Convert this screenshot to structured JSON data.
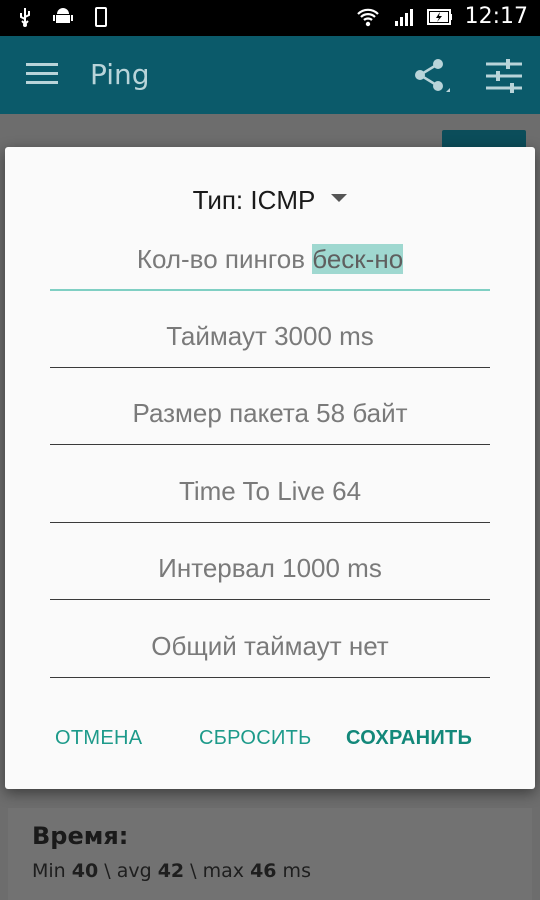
{
  "status_bar": {
    "time": "12:17",
    "icons": [
      "usb-icon",
      "android-debug-icon",
      "screenshot-icon",
      "wifi-icon",
      "signal-icon",
      "battery-charging-icon"
    ]
  },
  "app_bar": {
    "title": "Ping",
    "icons": [
      "menu-icon",
      "share-icon",
      "tune-icon"
    ]
  },
  "dialog": {
    "type_label": "Тип: ICMP",
    "fields": [
      {
        "label": "Кол-во пингов ",
        "value": "беск-но",
        "highlight": true
      },
      {
        "label": "Таймаут 3000 ms"
      },
      {
        "label": "Размер пакета 58 байт"
      },
      {
        "label": "Time To Live 64"
      },
      {
        "label": "Интервал 1000 ms"
      },
      {
        "label": "Общий таймаут нет"
      }
    ],
    "actions": {
      "cancel": "ОТМЕНА",
      "reset": "СБРОСИТЬ",
      "save": "СОХРАНИТЬ"
    }
  },
  "stats": {
    "title": "Время:",
    "min_label": "Min ",
    "min_value": "40",
    "sep1": " \\ avg ",
    "avg_value": "42",
    "sep2": " \\ max ",
    "max_value": "46",
    "unit": " ms"
  },
  "colors": {
    "app_bar": "#0b5a6a",
    "accent": "#1d9a8a",
    "highlight": "#9fd8d0"
  }
}
